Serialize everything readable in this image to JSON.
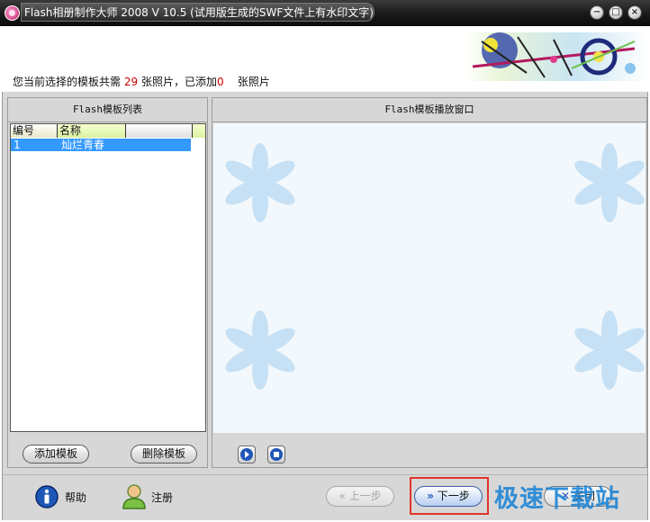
{
  "window": {
    "title": "Flash相册制作大师 2008 V 10.5 (试用版生成的SWF文件上有水印文字)",
    "buttons": {
      "minimize": "−",
      "maximize": "□",
      "close": "×"
    }
  },
  "info": {
    "prefix": "您当前选择的模板共需",
    "needed": "29",
    "mid": "张照片，已添加",
    "added": "0",
    "suffix": "张照片"
  },
  "left_panel": {
    "title": "Flash模板列表",
    "columns": [
      "编号",
      "名称"
    ],
    "rows": [
      {
        "id": "1",
        "name": "灿烂青春"
      }
    ],
    "add_label": "添加模板",
    "delete_label": "删除模板"
  },
  "right_panel": {
    "title": "Flash模板播放窗口"
  },
  "footer": {
    "help_label": "帮助",
    "register_label": "注册",
    "prev_label": "上一步",
    "next_label": "下一步",
    "close_label": "关闭"
  },
  "watermark": "极速下载站",
  "colors": {
    "accent": "#3399ff",
    "highlight_border": "#e0342b",
    "count_red": "#d00000"
  }
}
